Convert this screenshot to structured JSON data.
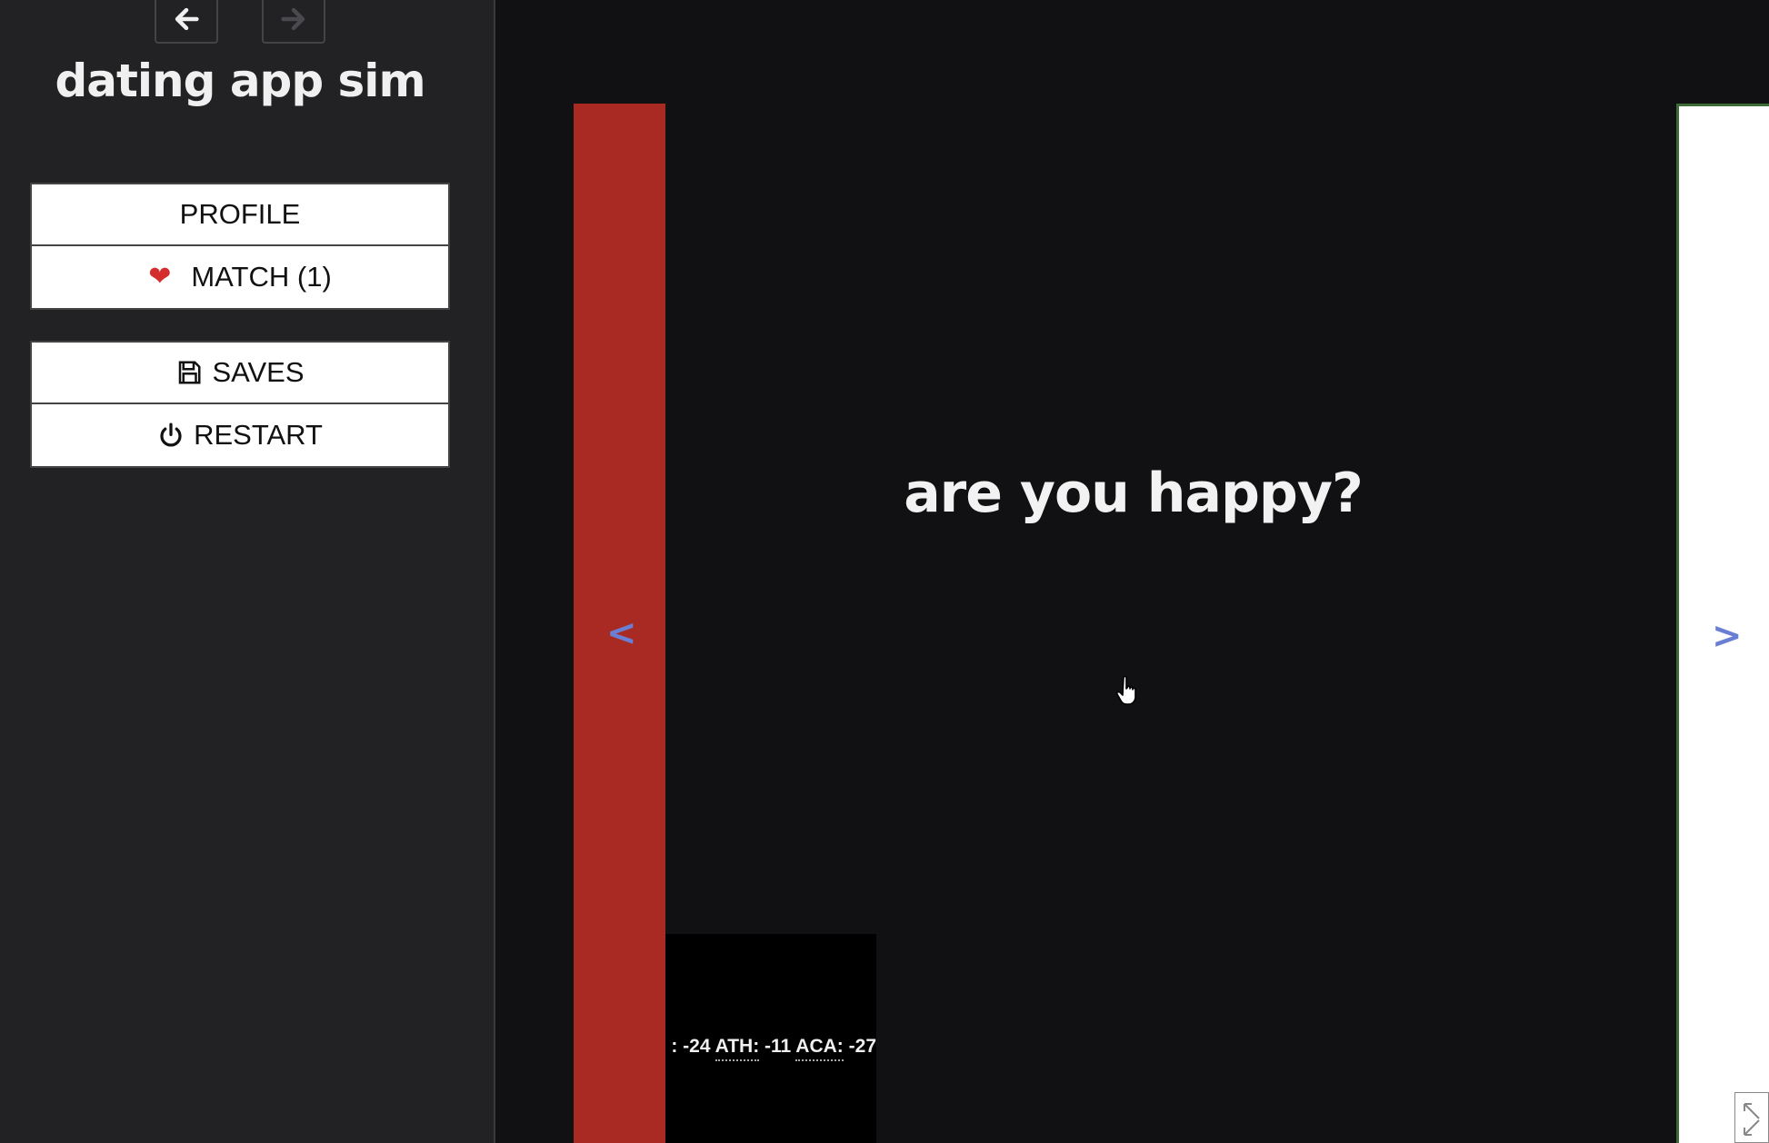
{
  "sidebar": {
    "title": "dating app sim",
    "history": {
      "back_icon": "arrow-left-icon",
      "forward_icon": "arrow-right-icon"
    },
    "menu": {
      "profile_label": "PROFILE",
      "match_label": "MATCH (1)",
      "match_icon": "heart-icon",
      "saves_label": "SAVES",
      "saves_icon": "floppy-disk-icon",
      "restart_label": "RESTART",
      "restart_icon": "power-icon"
    }
  },
  "passage": {
    "question": "are you happy?",
    "left_arrow": "<",
    "right_arrow": ">",
    "stats_line_lead": ": -24",
    "stats": [
      {
        "key": "ATH:",
        "value": "-11"
      },
      {
        "key": "ACA:",
        "value": "-27"
      }
    ]
  },
  "colors": {
    "sidebar_bg": "#222225",
    "main_bg": "#111114",
    "left_panel": "#a82a22",
    "right_panel": "#ffffff",
    "arrow": "#6a7fd4",
    "heart": "#d42d2d"
  }
}
